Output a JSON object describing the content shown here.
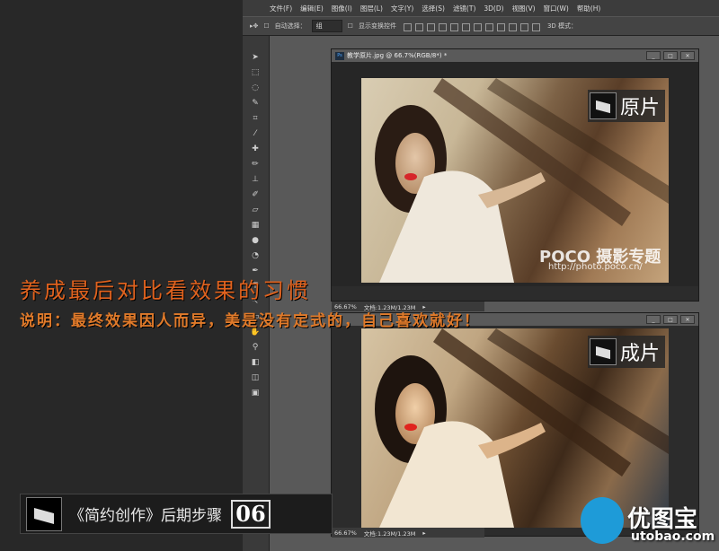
{
  "app": {
    "logo": "Ps"
  },
  "menubar": [
    "文件(F)",
    "编辑(E)",
    "图像(I)",
    "图层(L)",
    "文字(Y)",
    "选择(S)",
    "滤镜(T)",
    "3D(D)",
    "视图(V)",
    "窗口(W)",
    "帮助(H)"
  ],
  "options": {
    "auto_select": "自动选择：",
    "select_value": "组",
    "show_transform": "显示变换控件",
    "mode_3d": "3D 模式："
  },
  "tools": [
    "move-tool",
    "marquee-tool",
    "lasso-tool",
    "quick-select-tool",
    "crop-tool",
    "eyedropper-tool",
    "healing-tool",
    "brush-tool",
    "stamp-tool",
    "history-brush-tool",
    "eraser-tool",
    "gradient-tool",
    "blur-tool",
    "dodge-tool",
    "pen-tool",
    "type-tool",
    "path-select-tool",
    "shape-tool",
    "hand-tool",
    "zoom-tool"
  ],
  "doc_top": {
    "title": "教学原片.jpg @ 66.7%(RGB/8*) *",
    "zoom": "66.67%",
    "doc_size": "文档:1.23M/1.23M",
    "badge": "原片",
    "watermark": "POCO 摄影专题",
    "watermark_url": "http://photo.poco.cn/"
  },
  "doc_bottom": {
    "zoom": "66.67%",
    "doc_size": "文档:1.23M/1.23M",
    "badge": "成片"
  },
  "overlay": {
    "headline": "养成最后对比看效果的习惯",
    "subline": "说明：最终效果因人而异，美是没有定式的，自己喜欢就好！"
  },
  "footer": {
    "series": "《简约创作》后期步骤",
    "step": "06"
  },
  "site_logo": {
    "cn": "优图宝",
    "en": "utobao.com"
  }
}
